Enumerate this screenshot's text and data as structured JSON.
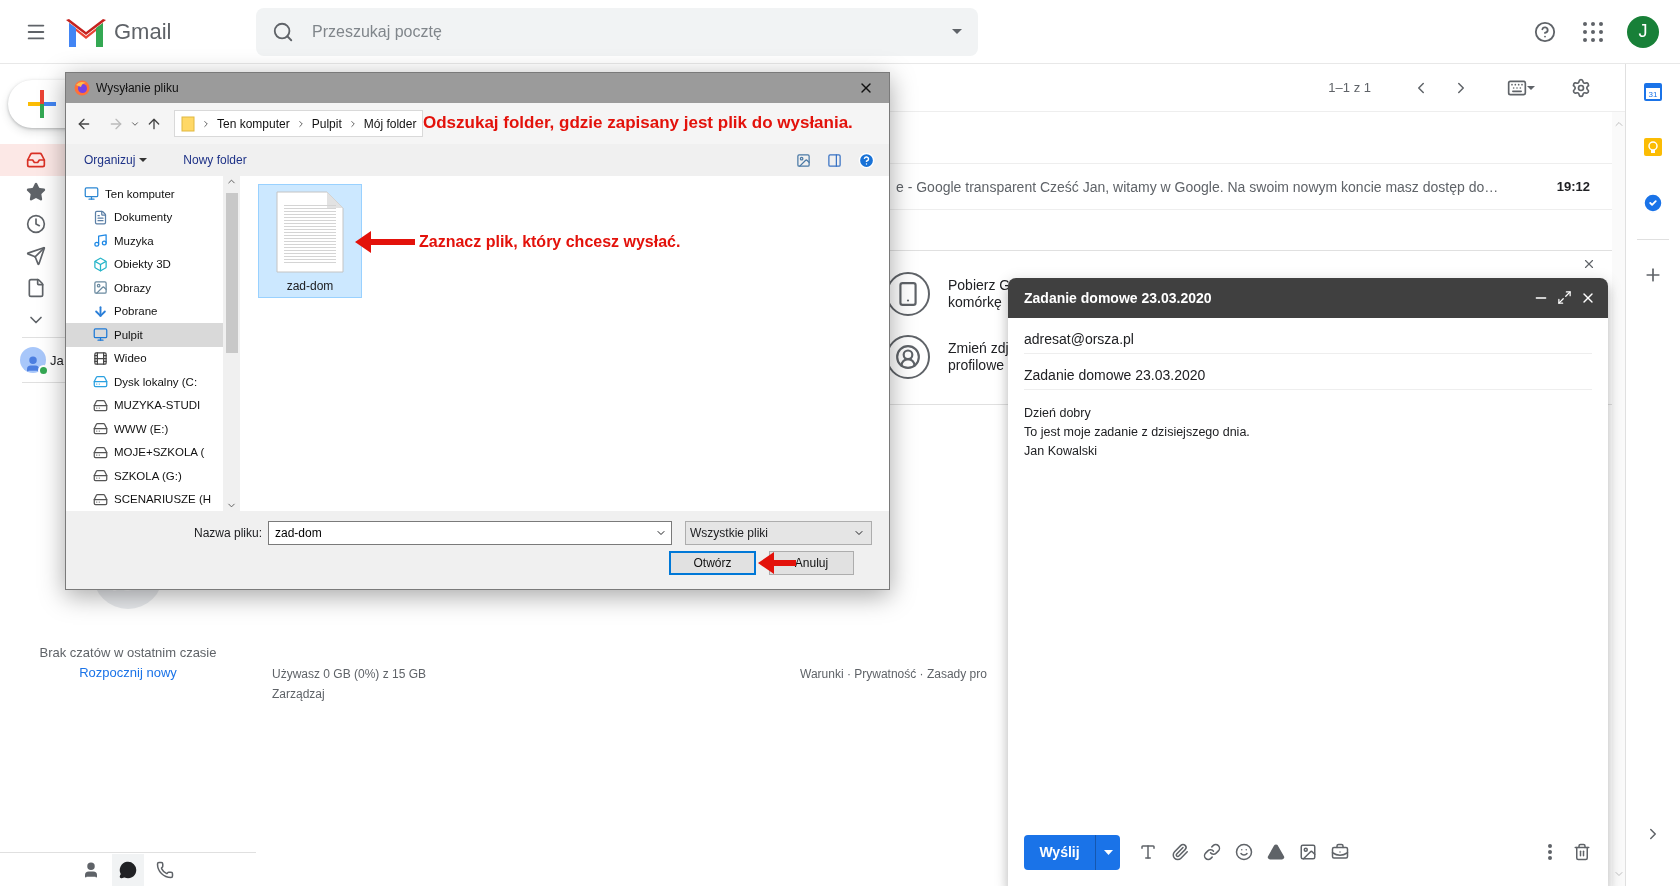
{
  "header": {
    "logo": "Gmail",
    "search_placeholder": "Przeszukaj pocztę",
    "avatar": "J"
  },
  "sidebar": {
    "nav": [
      {
        "kind": "inbox",
        "selected": true
      },
      {
        "kind": "starred",
        "selected": false
      },
      {
        "kind": "snoozed",
        "selected": false
      },
      {
        "kind": "sent",
        "selected": false
      },
      {
        "kind": "drafts",
        "selected": false
      },
      {
        "kind": "more",
        "selected": false
      }
    ],
    "contact": {
      "name": "Ja",
      "online": true
    },
    "chat_empty": "Brak czatów w ostatnim czasie",
    "chat_start": "Rozpocznij nowy",
    "bottom_tabs": [
      {
        "kind": "contacts",
        "selected": false
      },
      {
        "kind": "hangouts",
        "selected": true
      },
      {
        "kind": "phone",
        "selected": false
      }
    ]
  },
  "toolbar": {
    "pagination": "1–1 z 1"
  },
  "messages": [
    {
      "snippet": "e - Google transparent Cześć Jan, witamy w Google. Na swoim nowym koncie masz dostęp do…",
      "time": "19:12",
      "unread": true
    }
  ],
  "promo": [
    {
      "kind": "phone",
      "lines": [
        "Pobierz G",
        "komórkę"
      ]
    },
    {
      "kind": "profile",
      "lines": [
        "Zmień zdj",
        "profilowe"
      ]
    }
  ],
  "footer": {
    "storage": "Używasz 0 GB (0%) z 15 GB",
    "manage": "Zarządzaj",
    "links": "Warunki · Prywatność · Zasady pro"
  },
  "side_apps": [
    {
      "kind": "calendar",
      "label": "31"
    },
    {
      "kind": "keep"
    },
    {
      "kind": "tasks"
    }
  ],
  "dialog": {
    "title": "Wysyłanie pliku",
    "path": [
      "Ten komputer",
      "Pulpit",
      "Mój folder"
    ],
    "commands": [
      {
        "label": "Organizuj",
        "menu": true
      },
      {
        "label": "Nowy folder",
        "menu": false
      }
    ],
    "nav": [
      {
        "label": "Ten komputer",
        "kind": "computer",
        "selected": false,
        "children": [
          {
            "label": "Dokumenty",
            "kind": "documents",
            "selected": false
          },
          {
            "label": "Muzyka",
            "kind": "music",
            "selected": false
          },
          {
            "label": "Obiekty 3D",
            "kind": "objects",
            "selected": false
          },
          {
            "label": "Obrazy",
            "kind": "pictures",
            "selected": false
          },
          {
            "label": "Pobrane",
            "kind": "downloads",
            "selected": false
          },
          {
            "label": "Pulpit",
            "kind": "desktop",
            "selected": true
          },
          {
            "label": "Wideo",
            "kind": "videos",
            "selected": false
          },
          {
            "label": "Dysk lokalny (C:",
            "kind": "system_drive",
            "selected": false
          },
          {
            "label": "MUZYKA-STUDI",
            "kind": "drive",
            "selected": false
          },
          {
            "label": "WWW (E:)",
            "kind": "drive",
            "selected": false
          },
          {
            "label": "MOJE+SZKOLA (",
            "kind": "drive",
            "selected": false
          },
          {
            "label": "SZKOLA (G:)",
            "kind": "drive",
            "selected": false
          },
          {
            "label": "SCENARIUSZE (H",
            "kind": "drive",
            "selected": false
          }
        ]
      }
    ],
    "files": [
      {
        "name": "zad-dom",
        "selected": true
      }
    ],
    "filename_label": "Nazwa pliku:",
    "filename": "zad-dom",
    "filter": "Wszystkie pliki",
    "buttons": [
      {
        "label": "Otwórz",
        "default": true
      },
      {
        "label": "Anuluj",
        "default": false
      }
    ]
  },
  "annotations": [
    {
      "kind": "text",
      "text": "Odszukaj folder, gdzie zapisany jest plik do wysłania."
    },
    {
      "kind": "arrow_text",
      "text": "Zaznacz plik, który chcesz wysłać."
    },
    {
      "kind": "arrow"
    }
  ],
  "compose": {
    "title": "Zadanie domowe 23.03.2020",
    "to": "adresat@orsza.pl",
    "subject": "Zadanie domowe 23.03.2020",
    "body": [
      "Dzień dobry",
      "To jest moje zadanie z dzisiejszego dnia.",
      "Jan Kowalski"
    ],
    "send": "Wyślij"
  }
}
